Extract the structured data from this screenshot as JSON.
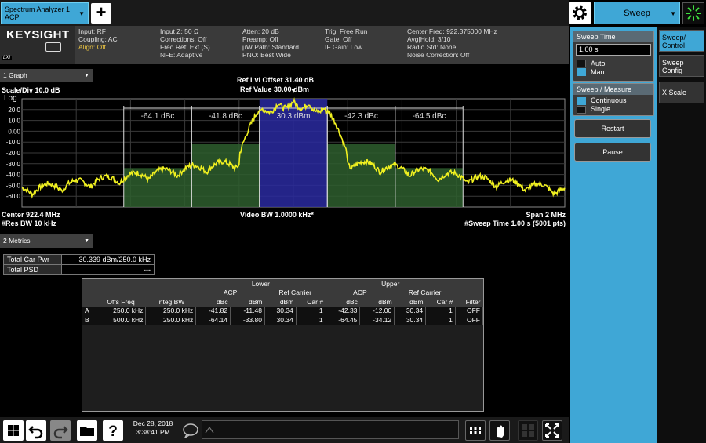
{
  "app_tab": {
    "line1": "Spectrum Analyzer 1",
    "line2": "ACP"
  },
  "top_menu": {
    "label": "Sweep"
  },
  "brand": "KEYSIGHT",
  "lxi_label": "LXI",
  "status": {
    "col1": [
      "Input: RF",
      "Coupling: AC",
      "Align: Off"
    ],
    "col2": [
      "Input Z: 50 Ω",
      "Corrections: Off",
      "Freq Ref: Ext (S)",
      "NFE: Adaptive"
    ],
    "col3": [
      "Atten: 20 dB",
      "Preamp: Off",
      "µW Path: Standard",
      "PNO: Best Wide"
    ],
    "col4": [
      "Trig: Free Run",
      "Gate: Off",
      "IF Gain: Low"
    ],
    "col5": [
      "Center Freq: 922.375000 MHz",
      "Avg|Hold: 3/10",
      "Radio Std: None",
      "Noise Correction: Off"
    ]
  },
  "graph": {
    "selector": "1 Graph",
    "scale_div": "Scale/Div 10.0 dB",
    "log_label": "Log",
    "ref_offset": "Ref Lvl Offset 31.40 dB",
    "ref_value": "Ref Value 30.00 dBm",
    "center": "Center 922.4 MHz",
    "res_bw": "#Res BW 10 kHz",
    "video_bw": "Video BW 1.0000 kHz*",
    "span": "Span 2 MHz",
    "sweep_time": "#Sweep Time 1.00 s (5001 pts)"
  },
  "chart_data": {
    "type": "line",
    "ylabel": "Log",
    "ylim": [
      -70,
      30
    ],
    "y_ticks": [
      "20.0",
      "10.0",
      "0.00",
      "-10.0",
      "-20.0",
      "-30.0",
      "-40.0",
      "-50.0",
      "-60.0"
    ],
    "band_labels": [
      {
        "text": "-64.1 dBc",
        "offset_khz": -500
      },
      {
        "text": "-41.8 dBc",
        "offset_khz": -250
      },
      {
        "text": "30.3 dBm",
        "offset_khz": 0
      },
      {
        "text": "-42.3 dBc",
        "offset_khz": 250
      },
      {
        "text": "-64.5 dBc",
        "offset_khz": 500
      }
    ],
    "bands": [
      {
        "name": "main",
        "from_khz": -125,
        "to_khz": 125,
        "level_dbm": 30
      },
      {
        "name": "adj-lower",
        "from_khz": -375,
        "to_khz": -125,
        "level_dbm": -12
      },
      {
        "name": "adj-upper",
        "from_khz": 125,
        "to_khz": 375,
        "level_dbm": -12
      },
      {
        "name": "alt-lower",
        "from_khz": -625,
        "to_khz": -375,
        "level_dbm": -34
      },
      {
        "name": "alt-upper",
        "from_khz": 375,
        "to_khz": 625,
        "level_dbm": -34
      }
    ],
    "trace_colors": {
      "trace": "#f0f020",
      "main_band": "#2a2aa0",
      "adj_band": "#2e5e2e",
      "alt_band": "#2e5e2e"
    }
  },
  "metrics": {
    "selector": "2 Metrics",
    "total_car_pwr_label": "Total Car Pwr",
    "total_car_pwr_value": "30.339 dBm/250.0 kHz",
    "total_psd_label": "Total PSD",
    "total_psd_value": "---",
    "table": {
      "group_lower": "Lower",
      "group_upper": "Upper",
      "acp": "ACP",
      "ref_carrier": "Ref Carrier",
      "headers": [
        "Offs Freq",
        "Integ BW",
        "dBc",
        "dBm",
        "dBm",
        "Car #",
        "dBc",
        "dBm",
        "dBm",
        "Car #",
        "Filter"
      ],
      "rows": [
        [
          "A",
          "250.0 kHz",
          "250.0 kHz",
          "-41.82",
          "-11.48",
          "30.34",
          "1",
          "-42.33",
          "-12.00",
          "30.34",
          "1",
          "OFF"
        ],
        [
          "B",
          "500.0 kHz",
          "250.0 kHz",
          "-64.14",
          "-33.80",
          "30.34",
          "1",
          "-64.45",
          "-34.12",
          "30.34",
          "1",
          "OFF"
        ]
      ]
    }
  },
  "taskbar": {
    "date": "Dec 28, 2018",
    "time": "3:38:41 PM"
  },
  "menu": {
    "sweep_time_title": "Sweep Time",
    "sweep_time_value": "1.00 s",
    "auto": "Auto",
    "man": "Man",
    "sweep_measure_title": "Sweep / Measure",
    "continuous": "Continuous",
    "single": "Single",
    "restart": "Restart",
    "pause": "Pause"
  },
  "side_tabs": [
    "Sweep/ Control",
    "Sweep Config",
    "X Scale"
  ],
  "colors": {
    "accent": "#3fa7d6",
    "trace": "#f0f020"
  }
}
